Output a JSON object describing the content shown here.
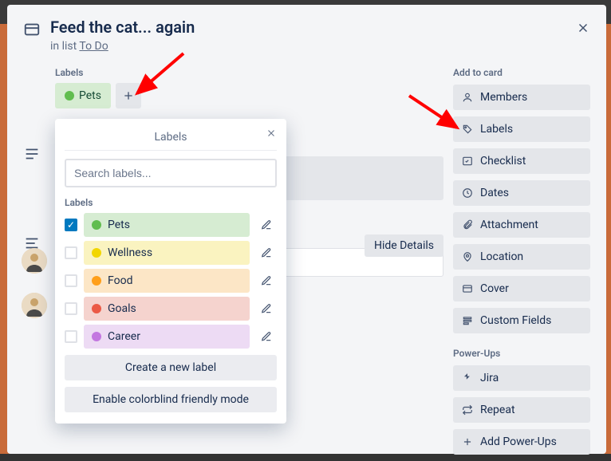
{
  "card": {
    "title": "Feed the cat... again",
    "in_list_prefix": "in list ",
    "list_name": "To Do"
  },
  "labels_section": {
    "heading": "Labels",
    "applied": [
      {
        "name": "Pets",
        "bg": "#d6ecd2",
        "dot": "#61bd4f"
      }
    ]
  },
  "popover": {
    "title": "Labels",
    "search_placeholder": "Search labels...",
    "section_label": "Labels",
    "items": [
      {
        "name": "Pets",
        "checked": true,
        "bg": "#d6ecd2",
        "dot": "#61bd4f"
      },
      {
        "name": "Wellness",
        "checked": false,
        "bg": "#faf3c0",
        "dot": "#f2d600"
      },
      {
        "name": "Food",
        "checked": false,
        "bg": "#fce6c6",
        "dot": "#ff9f1a"
      },
      {
        "name": "Goals",
        "checked": false,
        "bg": "#f5d3ce",
        "dot": "#eb5a46"
      },
      {
        "name": "Career",
        "checked": false,
        "bg": "#eddbf4",
        "dot": "#c377e0"
      }
    ],
    "create_label_btn": "Create a new label",
    "colorblind_btn": "Enable colorblind friendly mode"
  },
  "activity": {
    "hide_details": "Hide Details"
  },
  "sidebar": {
    "add_to_card_heading": "Add to card",
    "items": [
      {
        "icon": "user-icon",
        "label": "Members"
      },
      {
        "icon": "tag-icon",
        "label": "Labels"
      },
      {
        "icon": "checklist-icon",
        "label": "Checklist"
      },
      {
        "icon": "clock-icon",
        "label": "Dates"
      },
      {
        "icon": "paperclip-icon",
        "label": "Attachment"
      },
      {
        "icon": "location-icon",
        "label": "Location"
      },
      {
        "icon": "cover-icon",
        "label": "Cover"
      },
      {
        "icon": "fields-icon",
        "label": "Custom Fields"
      }
    ],
    "powerups_heading": "Power-Ups",
    "powerups": [
      {
        "icon": "jira-icon",
        "label": "Jira"
      },
      {
        "icon": "repeat-icon",
        "label": "Repeat"
      }
    ],
    "add_powerups": "Add Power-Ups"
  }
}
